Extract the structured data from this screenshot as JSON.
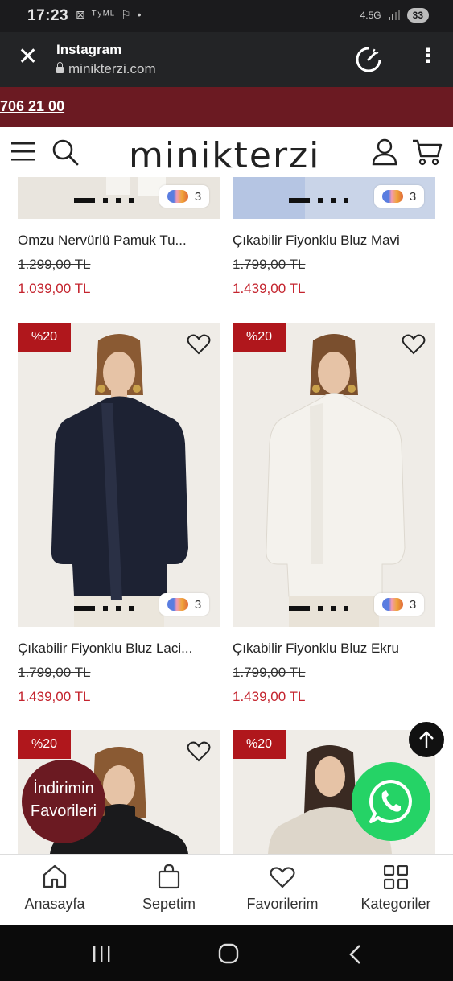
{
  "status_bar": {
    "time": "17:23",
    "left_icons": "⊠ ᵀʸᴹᴸ ⚐ •",
    "network": "4.5G",
    "battery": "33"
  },
  "browser_bar": {
    "app": "Instagram",
    "url": "minikterzi.com",
    "close_icon": "close-icon",
    "menu_icon": "more-vertical-icon"
  },
  "promo": {
    "phone": "706 21 00"
  },
  "header": {
    "logo": "minikterzi"
  },
  "products": [
    {
      "name": "Omzu Nervürlü Pamuk Tu...",
      "old_price": "1.299,00 TL",
      "new_price": "1.039,00 TL",
      "colors": "3"
    },
    {
      "name": "Çıkabilir Fiyonklu Bluz Mavi",
      "old_price": "1.799,00 TL",
      "new_price": "1.439,00 TL",
      "colors": "3"
    },
    {
      "name": "Çıkabilir Fiyonklu Bluz Laci...",
      "old_price": "1.799,00 TL",
      "new_price": "1.439,00 TL",
      "colors": "3",
      "badge": "%20"
    },
    {
      "name": "Çıkabilir Fiyonklu Bluz Ekru",
      "old_price": "1.799,00 TL",
      "new_price": "1.439,00 TL",
      "colors": "3",
      "badge": "%20"
    },
    {
      "badge": "%20"
    },
    {
      "badge": "%20"
    }
  ],
  "fav_bubble": {
    "line1": "İndirimin",
    "line2": "Favorileri"
  },
  "bottom_nav": [
    {
      "label": "Anasayfa",
      "icon": "home-icon"
    },
    {
      "label": "Sepetim",
      "icon": "bag-icon"
    },
    {
      "label": "Favorilerim",
      "icon": "heart-icon"
    },
    {
      "label": "Kategoriler",
      "icon": "grid-icon"
    }
  ],
  "colors": {
    "brand": "#6b1a22",
    "sale": "#c4242e",
    "badge": "#b0171c",
    "whatsapp": "#25d366"
  }
}
